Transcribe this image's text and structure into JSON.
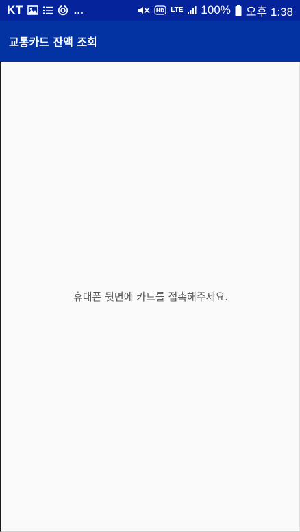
{
  "status_bar": {
    "carrier": "KT",
    "notification_icons": [
      "image-icon",
      "list-icon",
      "sync-icon"
    ],
    "more": "...",
    "system_icons": [
      "mute-icon",
      "hd-voice-icon",
      "lte-icon",
      "signal-icon"
    ],
    "network": "LTE",
    "battery_percent": "100%",
    "time": "오후 1:38"
  },
  "app_bar": {
    "title": "교통카드 잔액 조회"
  },
  "main": {
    "message": "휴대폰 뒷면에 카드를 접촉해주세요."
  },
  "colors": {
    "status_bar": "#05239a",
    "app_bar": "#0332a3",
    "background": "#fafafa",
    "message_text": "#555555"
  }
}
